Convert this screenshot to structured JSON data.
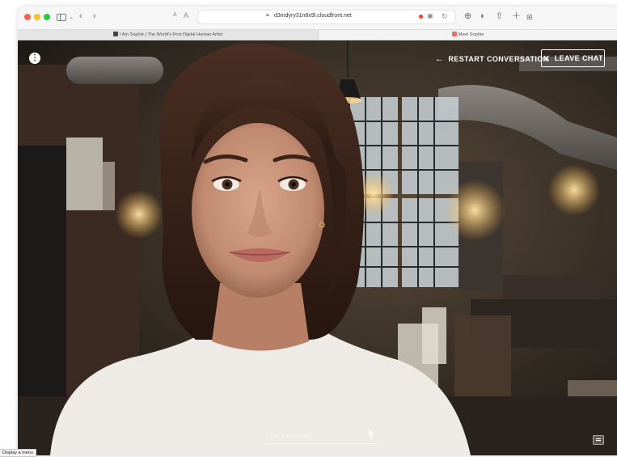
{
  "browser": {
    "url": "d3mdyry31n8x9l.cloudfront.net",
    "font_size_small": "A",
    "font_size_large": "A",
    "tabs": [
      {
        "title": "I Am Sophie | The World's First Digital Human Artist",
        "active": false
      },
      {
        "title": "Meet Sophie",
        "active": true
      }
    ]
  },
  "app": {
    "restart_label": "RESTART CONVERSATION",
    "leave_label": "LEAVE CHAT",
    "chat_placeholder": "Type something",
    "colors": {
      "accent": "#ffffff",
      "overlay_text": "#ffffff"
    }
  },
  "tooltip": "Display a menu"
}
